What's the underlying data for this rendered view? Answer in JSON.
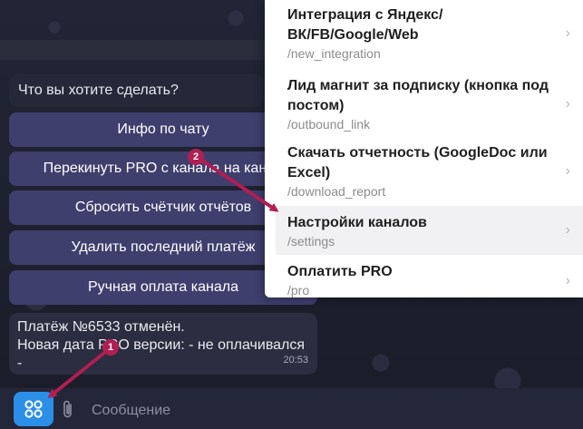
{
  "chat": {
    "prompt": "Что вы хотите сделать?",
    "keyboard_buttons": [
      "Инфо по чату",
      "Перекинуть PRO с канала на канал",
      "Сбросить счётчик отчётов",
      "Удалить последний платёж",
      "Ручная оплата канала"
    ],
    "message_line1": "Платёж №6533 отменён.",
    "message_line2": "Новая дата PRO версии: - не оплачивался -",
    "message_time": "20:53"
  },
  "composer": {
    "placeholder": "Сообщение",
    "menu_icon": "grid-icon",
    "attach_icon": "paperclip-icon"
  },
  "commands": [
    {
      "title": "Интеграция с Яндекс/ ВК/FB/Google/Web",
      "path": "/new_integration"
    },
    {
      "title": "Лид магнит за подписку (кнопка под постом)",
      "path": "/outbound_link"
    },
    {
      "title": "Скачать отчетность (GoogleDoc или Excel)",
      "path": "/download_report"
    },
    {
      "title": "Настройки каналов",
      "path": "/settings"
    },
    {
      "title": "Оплатить PRO",
      "path": "/pro"
    }
  ],
  "annotations": {
    "callout_1": "1",
    "callout_2": "2"
  },
  "colors": {
    "menu_button": "#2b8fe8",
    "keyboard_button": "#3f3f6e",
    "arrow": "#b01e52"
  }
}
